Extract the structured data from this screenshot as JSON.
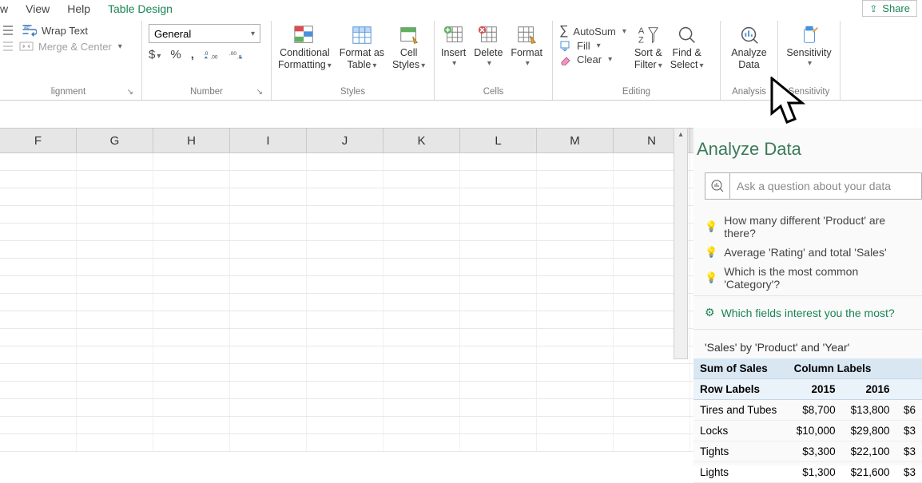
{
  "menu": {
    "items": [
      "w",
      "View",
      "Help",
      "Table Design"
    ],
    "active_index": 3
  },
  "share": {
    "label": "Share"
  },
  "ribbon": {
    "alignment": {
      "wrap": "Wrap Text",
      "merge": "Merge & Center",
      "group_label": "lignment"
    },
    "number": {
      "format": "General",
      "group_label": "Number"
    },
    "styles": {
      "cond": "Conditional",
      "cond2": "Formatting",
      "fat": "Format as",
      "fat2": "Table",
      "cell": "Cell",
      "cell2": "Styles",
      "group_label": "Styles"
    },
    "cells": {
      "insert": "Insert",
      "delete": "Delete",
      "format": "Format",
      "group_label": "Cells"
    },
    "editing": {
      "autosum": "AutoSum",
      "fill": "Fill",
      "clear": "Clear",
      "sort": "Sort &",
      "sort2": "Filter",
      "find": "Find &",
      "find2": "Select",
      "group_label": "Editing"
    },
    "analysis": {
      "analyze": "Analyze",
      "analyze2": "Data",
      "group_label": "Analysis"
    },
    "sensitivity": {
      "sens": "Sensitivity",
      "group_label": "Sensitivity"
    }
  },
  "columns": [
    "F",
    "G",
    "H",
    "I",
    "J",
    "K",
    "L",
    "M",
    "N"
  ],
  "pane": {
    "title": "Analyze Data",
    "search_placeholder": "Ask a question about your data",
    "suggestions": [
      "How many different 'Product' are there?",
      "Average 'Rating' and total 'Sales'",
      "Which is the most common 'Category'?"
    ],
    "interest": "Which fields interest you the most?",
    "insight_title": "'Sales' by 'Product' and 'Year'",
    "table": {
      "h1": "Sum of Sales",
      "h2": "Column Labels",
      "r2a": "Row Labels",
      "r2b": "2015",
      "r2c": "2016",
      "rows": [
        {
          "label": "Tires and Tubes",
          "a": "$8,700",
          "b": "$13,800",
          "c": "$6"
        },
        {
          "label": "Locks",
          "a": "$10,000",
          "b": "$29,800",
          "c": "$3"
        },
        {
          "label": "Tights",
          "a": "$3,300",
          "b": "$22,100",
          "c": "$3"
        },
        {
          "label": "Lights",
          "a": "$1,300",
          "b": "$21,600",
          "c": "$3"
        }
      ]
    }
  }
}
